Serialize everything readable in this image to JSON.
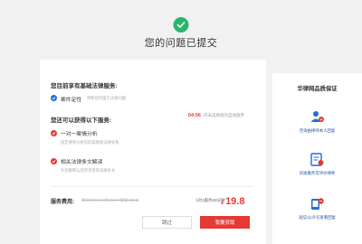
{
  "header": {
    "title": "您的问题已提交"
  },
  "main": {
    "enjoyed_title": "您目前享有基础法律服务:",
    "enjoyed_items": [
      {
        "title": "案件定性",
        "desc": "判断您所属于法律问题"
      }
    ],
    "available_title": "您还可以获得以下服务:",
    "timer": {
      "time": "04:56",
      "text": "内未选择视为自动放弃"
    },
    "available_items": [
      {
        "title": "一对一案情分析",
        "desc": "指定律师分析您的案情及法律关系"
      },
      {
        "title": "相关法律条文解读",
        "desc": "为您解释与您所享受的法律条文"
      }
    ],
    "fee": {
      "label": "服务费用:",
      "original": "原价¥98.0(分析¥60.0+解读¥38.0)",
      "quota": "1对1服务60分钟",
      "currency": "¥",
      "price": "19.8"
    },
    "buttons": {
      "skip": "跳过",
      "buy": "我要获取"
    }
  },
  "sidebar": {
    "title": "华律网品质保证",
    "features": [
      {
        "label": "咨询由律师本人回复",
        "icon": "lawyer-user-icon"
      },
      {
        "label": "优质服务可评价律师",
        "icon": "certificate-icon"
      },
      {
        "label": "短信/公众号查看回复",
        "icon": "message-phone-icon"
      }
    ]
  },
  "colors": {
    "success": "#2bb56c",
    "accent": "#e53935",
    "brand_blue": "#1f6fd6",
    "background": "#f1f1f1"
  }
}
